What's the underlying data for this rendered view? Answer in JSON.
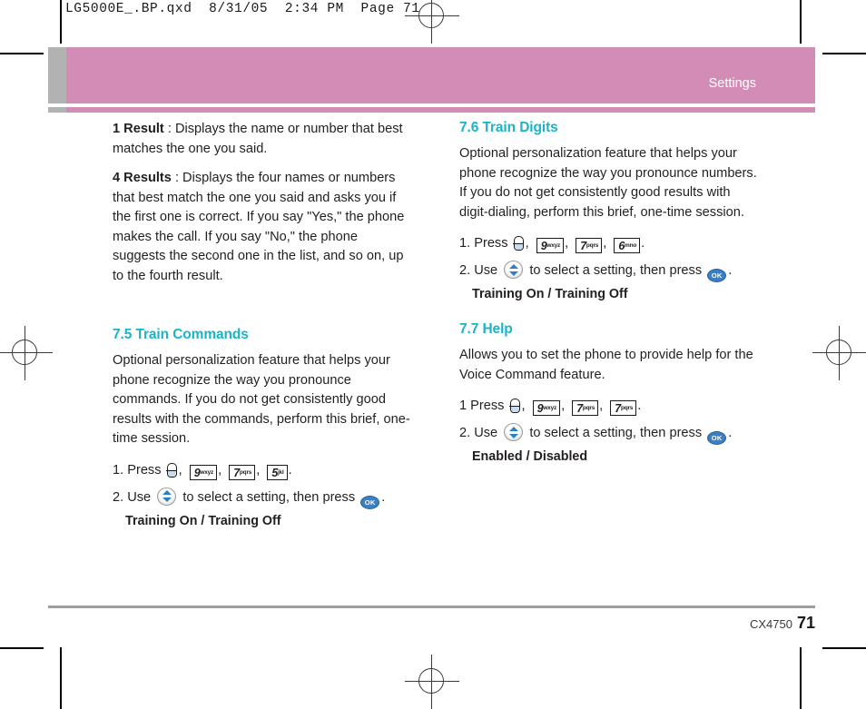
{
  "scan": {
    "file_info": "LG5000E_.BP.qxd  8/31/05  2:34 PM  Page 71"
  },
  "header": {
    "title": "Settings"
  },
  "left_column": {
    "intro": [
      {
        "bold": "1 Result",
        "text": " : Displays the name or number that best matches the one you said."
      },
      {
        "bold": "4 Results",
        "text": " : Displays the four names or numbers that best match the one you said and asks you if the first one is correct. If you say \"Yes,\" the phone makes the call. If you say \"No,\" the phone suggests the second one in the list, and so on, up to the fourth result."
      }
    ],
    "section": {
      "heading": "7.5 Train Commands",
      "body": "Optional personalization feature that helps your phone recognize the way you pronounce commands. If you do not get consistently good results with the commands, perform this brief, one-time session.",
      "step1_prefix": "1. Press",
      "step1_keys": [
        {
          "icon": "voice-key",
          "digit": "",
          "letters": ""
        },
        {
          "icon": "keypad-key",
          "digit": "9",
          "letters": "wxyz"
        },
        {
          "icon": "keypad-key",
          "digit": "7",
          "letters": "pqrs"
        },
        {
          "icon": "keypad-key",
          "digit": "5",
          "letters": "jkl"
        }
      ],
      "step2_prefix": "2. Use",
      "step2_middle": "to select a setting, then press",
      "step2_suffix": ".",
      "ok_label": "OK",
      "options": "Training On / Training Off"
    }
  },
  "right_column": {
    "section_train_digits": {
      "heading": "7.6 Train Digits",
      "body": "Optional personalization feature that helps your phone recognize the way you pronounce numbers. If you do not get consistently good results with digit-dialing, perform this brief, one-time session.",
      "step1_prefix": "1. Press",
      "step1_keys": [
        {
          "icon": "voice-key",
          "digit": "",
          "letters": ""
        },
        {
          "icon": "keypad-key",
          "digit": "9",
          "letters": "wxyz"
        },
        {
          "icon": "keypad-key",
          "digit": "7",
          "letters": "pqrs"
        },
        {
          "icon": "keypad-key",
          "digit": "6",
          "letters": "mno"
        }
      ],
      "step2_prefix": "2. Use",
      "step2_middle": "to select a setting, then press",
      "step2_suffix": ".",
      "ok_label": "OK",
      "options": "Training On / Training Off"
    },
    "section_help": {
      "heading": "7.7 Help",
      "body": "Allows you to set the phone to provide help for the Voice Command feature.",
      "step1_prefix": "1 Press",
      "step1_keys": [
        {
          "icon": "voice-key",
          "digit": "",
          "letters": ""
        },
        {
          "icon": "keypad-key",
          "digit": "9",
          "letters": "wxyz"
        },
        {
          "icon": "keypad-key",
          "digit": "7",
          "letters": "pqrs"
        },
        {
          "icon": "keypad-key",
          "digit": "7",
          "letters": "pqrs"
        }
      ],
      "step2_prefix": "2. Use",
      "step2_middle": "to select a setting, then press",
      "step2_suffix": ".",
      "ok_label": "OK",
      "options": "Enabled / Disabled"
    }
  },
  "footer": {
    "model": "CX4750",
    "page_number": "71"
  },
  "colors": {
    "header_pink": "#d38cb5",
    "header_gray": "#b2b2b2",
    "heading_teal": "#1bb3c8",
    "ok_blue": "#3b7fc4",
    "footer_rule": "#9d9d9d"
  }
}
